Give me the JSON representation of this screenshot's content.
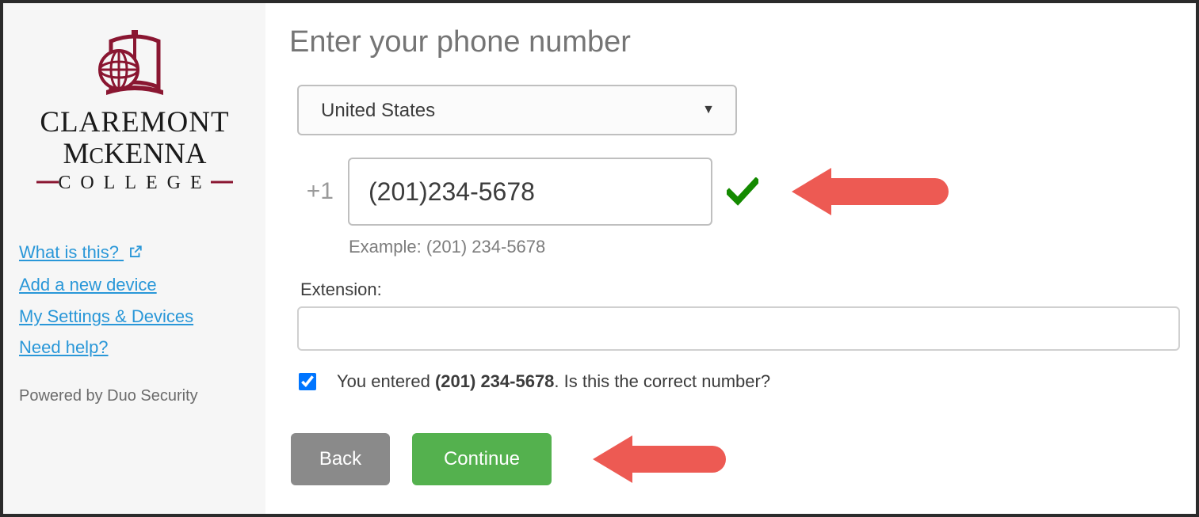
{
  "sidebar": {
    "links": {
      "what_is_this": "What is this?",
      "add_device": "Add a new device",
      "my_settings": "My Settings & Devices",
      "need_help": "Need help?"
    },
    "powered_by": "Powered by Duo Security"
  },
  "main": {
    "title": "Enter your phone number",
    "country_selected": "United States",
    "dial_code": "+1",
    "phone_value": "(201)234-5678",
    "phone_example": "Example: (201) 234-5678",
    "extension_label": "Extension:",
    "extension_value": "",
    "confirm_checked": true,
    "confirm_prefix": "You entered ",
    "confirm_number": "(201) 234-5678",
    "confirm_suffix": ". Is this the correct number?",
    "buttons": {
      "back": "Back",
      "continue": "Continue"
    }
  },
  "colors": {
    "link": "#2997d8",
    "accent_green": "#54b14e",
    "check_green": "#148a00",
    "arrow_red": "#ed5a53",
    "cmc_red": "#8a1631"
  }
}
